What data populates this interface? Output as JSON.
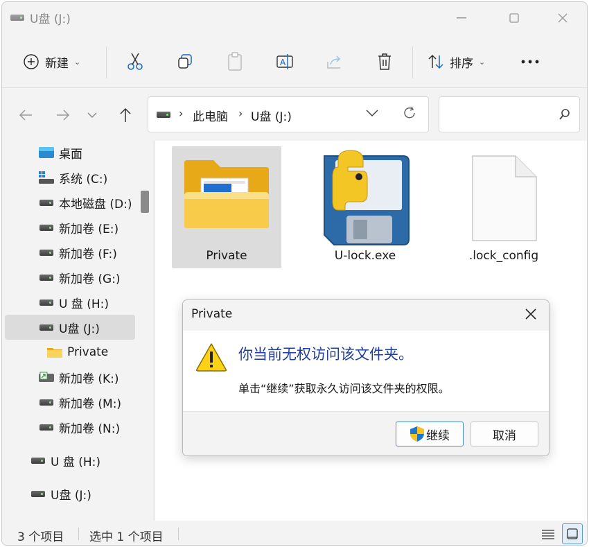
{
  "window": {
    "title": "U盘 (J:)"
  },
  "toolbar": {
    "new_label": "新建",
    "sort_label": "排序"
  },
  "address": {
    "crumbs": [
      "此电脑",
      "U盘 (J:)"
    ]
  },
  "sidebar": {
    "items": [
      {
        "label": "桌面",
        "icon": "desktop-icon"
      },
      {
        "label": "系统 (C:)",
        "icon": "windows-drive-icon"
      },
      {
        "label": "本地磁盘 (D:)",
        "icon": "drive-icon"
      },
      {
        "label": "新加卷 (E:)",
        "icon": "drive-icon"
      },
      {
        "label": "新加卷 (F:)",
        "icon": "drive-icon"
      },
      {
        "label": "新加卷 (G:)",
        "icon": "drive-icon"
      },
      {
        "label": "U 盘 (H:)",
        "icon": "usb-drive-icon"
      },
      {
        "label": "U盘 (J:)",
        "icon": "usb-drive-icon",
        "selected": true
      },
      {
        "label": "Private",
        "icon": "folder-icon"
      },
      {
        "label": "新加卷 (K:)",
        "icon": "shared-drive-icon"
      },
      {
        "label": "新加卷 (M:)",
        "icon": "drive-icon"
      },
      {
        "label": "新加卷 (N:)",
        "icon": "drive-icon"
      },
      {
        "label": "U 盘 (H:)",
        "icon": "usb-drive-icon"
      },
      {
        "label": "U盘 (J:)",
        "icon": "usb-drive-icon"
      }
    ]
  },
  "files": [
    {
      "name": "Private",
      "type": "folder",
      "selected": true
    },
    {
      "name": "U-lock.exe",
      "type": "executable"
    },
    {
      "name": ".lock_config",
      "type": "file"
    }
  ],
  "status": {
    "count": "3 个项目",
    "selection": "选中 1 个项目"
  },
  "dialog": {
    "title": "Private",
    "heading": "你当前无权访问该文件夹。",
    "message": "单击“继续”获取永久访问该文件夹的权限。",
    "continue_label": "继续",
    "cancel_label": "取消"
  },
  "colors": {
    "accent": "#1f3f9f",
    "selection": "#dcdcdc",
    "folder": "#f5c540"
  }
}
